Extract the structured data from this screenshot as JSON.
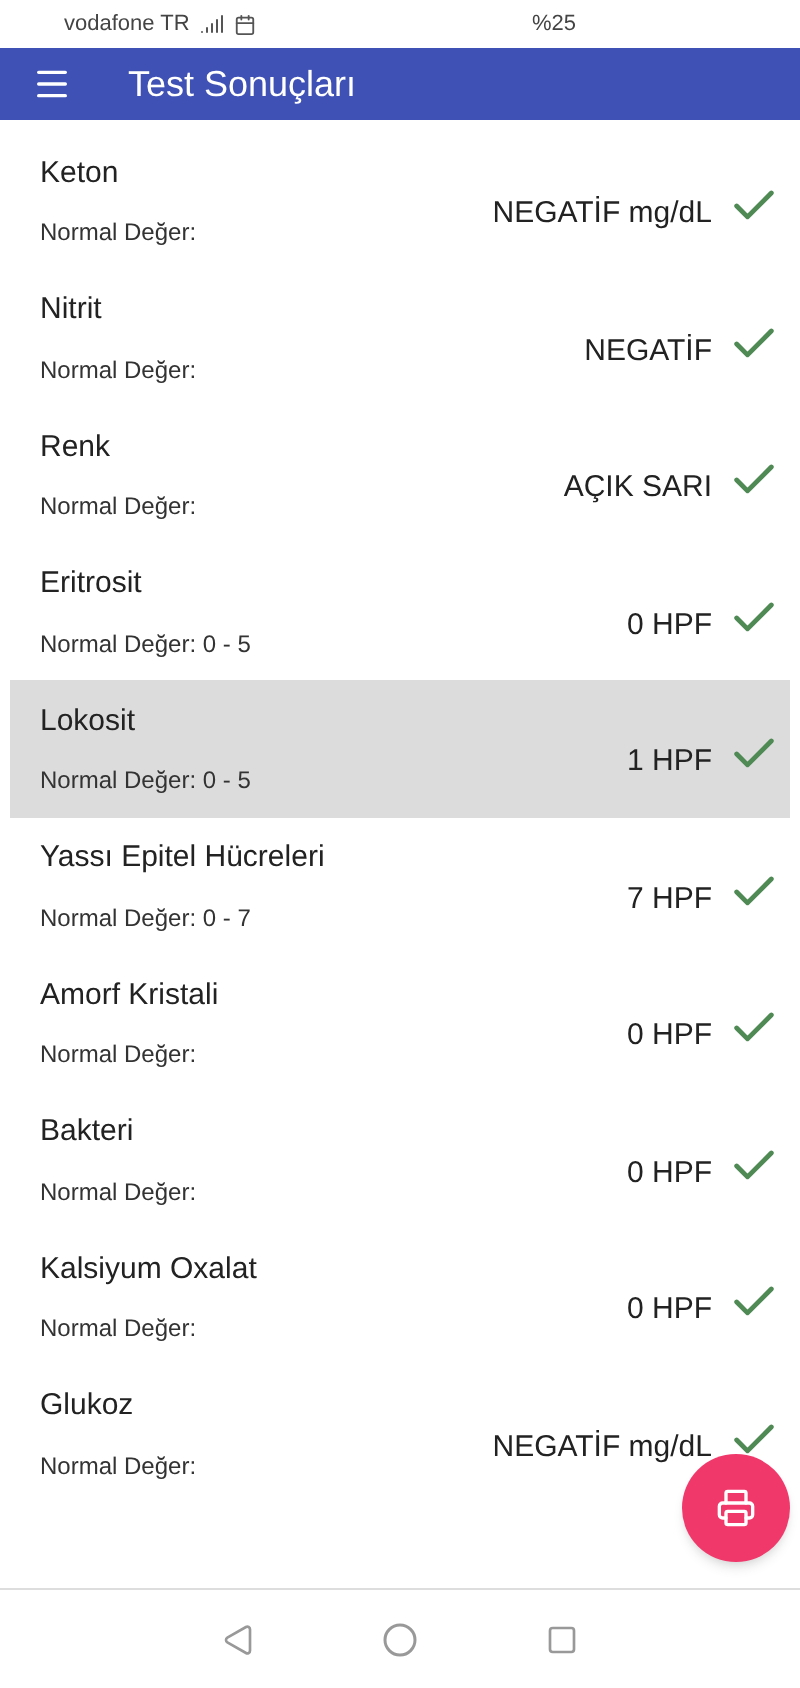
{
  "status_bar": {
    "carrier": "vodafone TR",
    "battery": "%25"
  },
  "app_bar": {
    "title": "Test Sonuçları"
  },
  "results": [
    {
      "name": "Keton",
      "normal": "Normal Değer:",
      "value": "NEGATİF mg/dL",
      "ok": true,
      "selected": false
    },
    {
      "name": "Nitrit",
      "normal": "Normal Değer:",
      "value": "NEGATİF",
      "ok": true,
      "selected": false
    },
    {
      "name": "Renk",
      "normal": "Normal Değer:",
      "value": "AÇIK SARI",
      "ok": true,
      "selected": false
    },
    {
      "name": "Eritrosit",
      "normal": "Normal Değer: 0 - 5",
      "value": "0 HPF",
      "ok": true,
      "selected": false
    },
    {
      "name": "Lokosit",
      "normal": "Normal Değer: 0 - 5",
      "value": "1 HPF",
      "ok": true,
      "selected": true
    },
    {
      "name": "Yassı Epitel Hücreleri",
      "normal": "Normal Değer: 0 - 7",
      "value": "7 HPF",
      "ok": true,
      "selected": false
    },
    {
      "name": "Amorf Kristali",
      "normal": "Normal Değer:",
      "value": "0 HPF",
      "ok": true,
      "selected": false
    },
    {
      "name": "Bakteri",
      "normal": "Normal Değer:",
      "value": "0 HPF",
      "ok": true,
      "selected": false
    },
    {
      "name": "Kalsiyum Oxalat",
      "normal": "Normal Değer:",
      "value": "0 HPF",
      "ok": true,
      "selected": false
    },
    {
      "name": "Glukoz",
      "normal": "Normal Değer:",
      "value": "NEGATİF mg/dL",
      "ok": true,
      "selected": false
    }
  ]
}
